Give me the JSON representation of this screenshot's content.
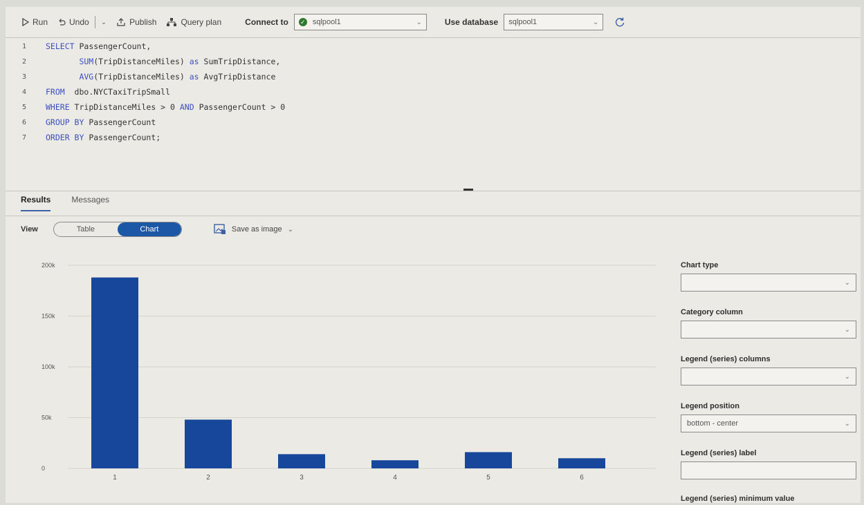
{
  "toolbar": {
    "run_label": "Run",
    "undo_label": "Undo",
    "publish_label": "Publish",
    "query_plan_label": "Query plan",
    "connect_to_label": "Connect to",
    "connect_to_value": "sqlpool1",
    "use_database_label": "Use database",
    "use_database_value": "sqlpool1"
  },
  "editor": {
    "lines": [
      {
        "n": "1",
        "kw1": "SELECT",
        "rest": " PassengerCount,"
      },
      {
        "n": "2",
        "kw1": "       SUM",
        "rest": "(TripDistanceMiles) ",
        "kw2": "as",
        "rest2": " SumTripDistance,"
      },
      {
        "n": "3",
        "kw1": "       AVG",
        "rest": "(TripDistanceMiles) ",
        "kw2": "as",
        "rest2": " AvgTripDistance"
      },
      {
        "n": "4",
        "kw1": "FROM",
        "rest": "  dbo.NYCTaxiTripSmall"
      },
      {
        "n": "5",
        "kw1": "WHERE",
        "rest": " TripDistanceMiles > 0 ",
        "kw2": "AND",
        "rest2": " PassengerCount > 0"
      },
      {
        "n": "6",
        "kw1": "GROUP BY",
        "rest": " PassengerCount"
      },
      {
        "n": "7",
        "kw1": "ORDER BY",
        "rest": " PassengerCount;"
      }
    ]
  },
  "results": {
    "tab_results": "Results",
    "tab_messages": "Messages",
    "view_label": "View",
    "view_table": "Table",
    "view_chart": "Chart",
    "save_as_image": "Save as image"
  },
  "chart_data": {
    "type": "bar",
    "categories": [
      "1",
      "2",
      "3",
      "4",
      "5",
      "6"
    ],
    "values": [
      188000,
      48000,
      14000,
      8000,
      16000,
      10000
    ],
    "yticks": [
      "200k",
      "150k",
      "100k",
      "50k",
      "0"
    ],
    "ylim": [
      0,
      200000
    ],
    "bar_color": "#17479a"
  },
  "panel": {
    "chart_type_label": "Chart type",
    "chart_type_value": "",
    "category_column_label": "Category column",
    "category_column_value": "",
    "legend_series_label": "Legend (series) columns",
    "legend_series_value": "",
    "legend_position_label": "Legend position",
    "legend_position_value": "bottom - center",
    "legend_series_label_label": "Legend (series) label",
    "legend_series_min_label": "Legend (series) minimum value"
  },
  "colors": {
    "accent": "#1d58a6",
    "connected": "#2f7a2f"
  }
}
